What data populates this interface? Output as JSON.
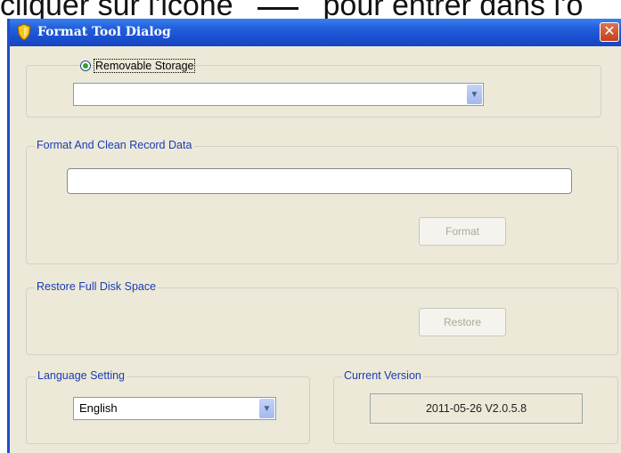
{
  "doc": {
    "text_before": "cliquer sur l'icône",
    "text_after": "pour entrer dans l'o"
  },
  "window": {
    "title": "Format Tool Dialog",
    "close_glyph": "✕"
  },
  "storage": {
    "radio_label": "Removable Storage",
    "selected": ""
  },
  "format_section": {
    "label": "Format And Clean Record Data",
    "field_value": "",
    "button": "Format"
  },
  "restore_section": {
    "label": "Restore Full Disk Space",
    "button": "Restore"
  },
  "language": {
    "label": "Language Setting",
    "selected": "English"
  },
  "version": {
    "label": "Current Version",
    "value": "2011-05-26 V2.0.5.8"
  },
  "icons": {
    "title": "shield-icon",
    "dropdown": "chevron-down-icon"
  },
  "colors": {
    "titlebar": "#1a4fd0",
    "group_label": "#1b3bb4",
    "dialog_bg": "#ece9d8",
    "close_button": "#c2401e"
  }
}
